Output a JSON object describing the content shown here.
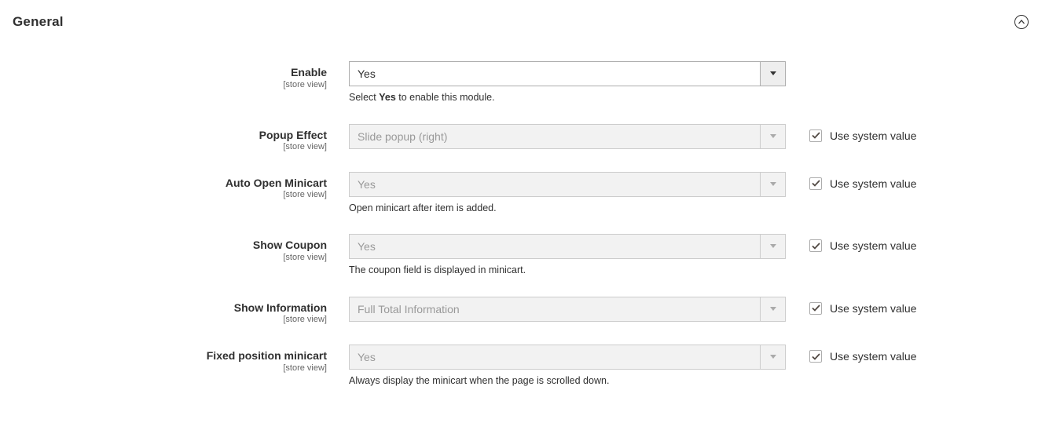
{
  "section_title": "General",
  "scope_label": "[store view]",
  "use_system_label": "Use system value",
  "fields": {
    "enable": {
      "label": "Enable",
      "value": "Yes",
      "note_pre": "Select ",
      "note_bold": "Yes",
      "note_post": " to enable this module."
    },
    "popup_effect": {
      "label": "Popup Effect",
      "value": "Slide popup (right)"
    },
    "auto_open": {
      "label": "Auto Open Minicart",
      "value": "Yes",
      "note": "Open minicart after item is added."
    },
    "show_coupon": {
      "label": "Show Coupon",
      "value": "Yes",
      "note": "The coupon field is displayed in minicart."
    },
    "show_info": {
      "label": "Show Information",
      "value": "Full Total Information"
    },
    "fixed_pos": {
      "label": "Fixed position minicart",
      "value": "Yes",
      "note": "Always display the minicart when the page is scrolled down."
    }
  }
}
